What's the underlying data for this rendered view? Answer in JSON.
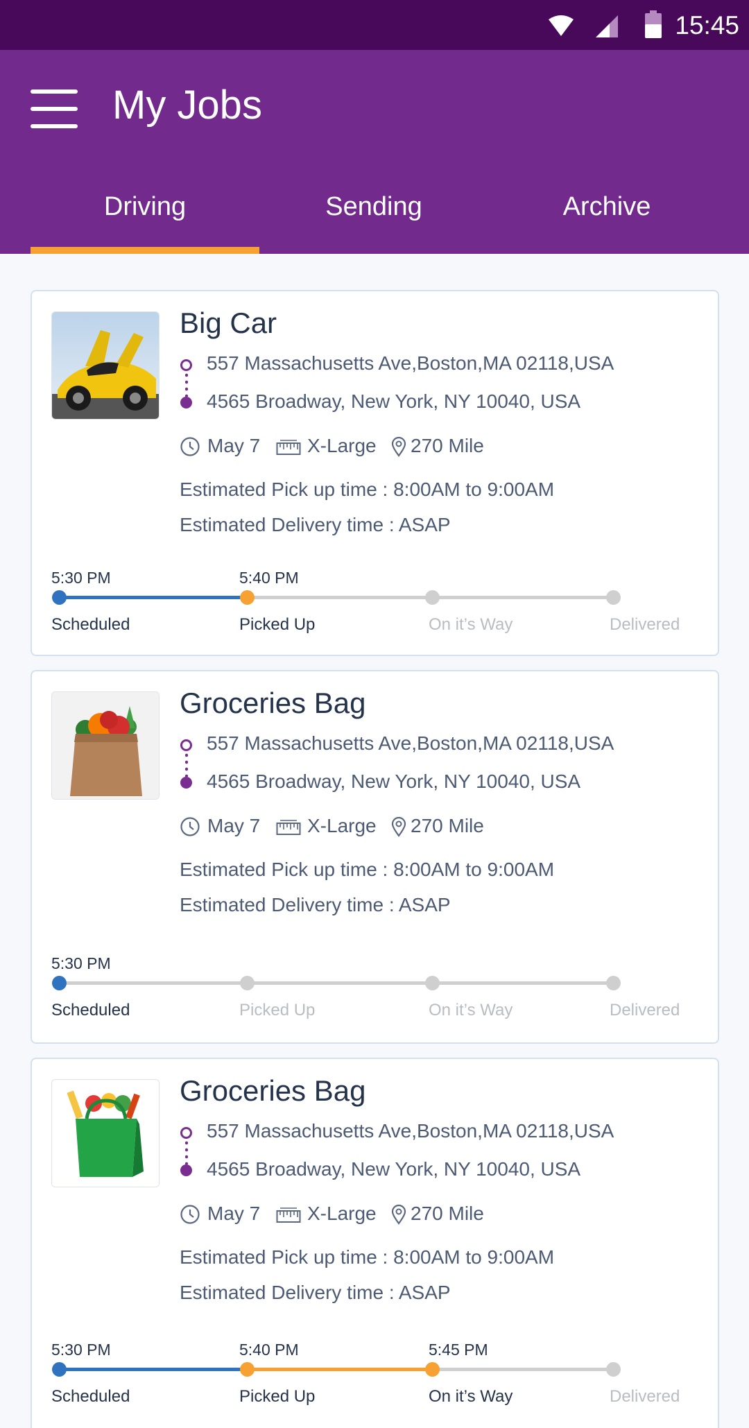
{
  "status_bar": {
    "time": "15:45",
    "icons": [
      "wifi-icon",
      "cell-signal-icon",
      "battery-icon"
    ]
  },
  "app_bar": {
    "menu_icon": "hamburger-menu-icon",
    "title": "My Jobs",
    "tabs": [
      {
        "label": "Driving",
        "active": true
      },
      {
        "label": "Sending",
        "active": false
      },
      {
        "label": "Archive",
        "active": false
      }
    ]
  },
  "colors": {
    "status_bar": "#48095a",
    "app_bar": "#722a8d",
    "tab_indicator": "#f6a131",
    "timeline_blue": "#2f73c0",
    "timeline_orange": "#f6a131",
    "timeline_inactive": "#cfcfcf",
    "route_purple": "#7a2d91"
  },
  "jobs": [
    {
      "title": "Big Car",
      "image": "yellow-sports-car-photo",
      "pickup_address": "557 Massachusetts Ave,Boston,MA 02118,USA",
      "dropoff_address": "4565 Broadway, New York, NY 10040, USA",
      "date": "May 7",
      "size": "X-Large",
      "distance": "270 Mile",
      "pickup_time": "Estimated Pick up time : 8:00AM to 9:00AM",
      "delivery_time": "Estimated Delivery time : ASAP",
      "timeline": {
        "stages": [
          "Scheduled",
          "Picked Up",
          "On it’s Way",
          "Delivered"
        ],
        "times": [
          "5:30 PM",
          "5:40 PM",
          "",
          ""
        ],
        "completed": 2
      }
    },
    {
      "title": "Groceries Bag",
      "image": "paper-grocery-bag-photo",
      "pickup_address": "557 Massachusetts Ave,Boston,MA 02118,USA",
      "dropoff_address": "4565 Broadway, New York, NY 10040, USA",
      "date": "May 7",
      "size": "X-Large",
      "distance": "270 Mile",
      "pickup_time": "Estimated Pick up time : 8:00AM to 9:00AM",
      "delivery_time": "Estimated Delivery time : ASAP",
      "timeline": {
        "stages": [
          "Scheduled",
          "Picked Up",
          "On it’s Way",
          "Delivered"
        ],
        "times": [
          "5:30 PM",
          "",
          "",
          ""
        ],
        "completed": 1
      }
    },
    {
      "title": "Groceries Bag",
      "image": "green-grocery-bag-photo",
      "pickup_address": "557 Massachusetts Ave,Boston,MA 02118,USA",
      "dropoff_address": "4565 Broadway, New York, NY 10040, USA",
      "date": "May 7",
      "size": "X-Large",
      "distance": "270 Mile",
      "pickup_time": "Estimated Pick up time : 8:00AM to 9:00AM",
      "delivery_time": "Estimated Delivery time : ASAP",
      "timeline": {
        "stages": [
          "Scheduled",
          "Picked Up",
          "On it’s Way",
          "Delivered"
        ],
        "times": [
          "5:30 PM",
          "5:40 PM",
          "5:45 PM",
          ""
        ],
        "completed": 3
      }
    }
  ]
}
